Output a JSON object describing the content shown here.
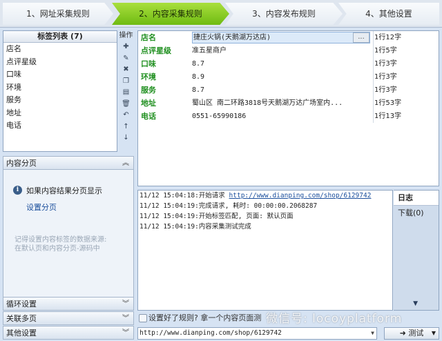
{
  "steps": [
    {
      "label": "1、网址采集规则"
    },
    {
      "label": "2、内容采集规则"
    },
    {
      "label": "3、内容发布规则"
    },
    {
      "label": "4、其他设置"
    }
  ],
  "taglist": {
    "header": "标签列表 (7)",
    "items": [
      "店名",
      "点评星级",
      "口味",
      "环境",
      "服务",
      "地址",
      "电话"
    ]
  },
  "ops": {
    "title": "操作",
    "icons": [
      "plus-icon",
      "pencil-icon",
      "delete-icon",
      "copy-icon",
      "paste-icon",
      "trash-icon",
      "undo-icon",
      "arrow-up-icon",
      "arrow-down-icon"
    ]
  },
  "grid": {
    "rows": [
      {
        "name": "店名",
        "value": "捷庄火锅(天鹅湖万达店)",
        "info": "1行12字",
        "button": "..."
      },
      {
        "name": "点评星级",
        "value": "准五星商户",
        "info": "1行5字"
      },
      {
        "name": "口味",
        "value": "8.7",
        "info": "1行3字"
      },
      {
        "name": "环境",
        "value": "8.9",
        "info": "1行3字"
      },
      {
        "name": "服务",
        "value": "8.7",
        "info": "1行3字"
      },
      {
        "name": "地址",
        "value": "蜀山区        南二环路3818号天鹅湖万达广场室内...",
        "info": "1行53字"
      },
      {
        "name": "电话",
        "value": "0551-65990186",
        "info": "1行13字"
      }
    ]
  },
  "left_panel": {
    "pager_title": "内容分页",
    "pager_hint": "如果内容结果分页显示",
    "pager_link": "设置分页",
    "pager_note": "记得设置内容标签的数据来源:\n在默认页和内容分页-源码中",
    "loop_settings": "循环设置",
    "related_pages": "关联多页",
    "other_settings": "其他设置"
  },
  "log": {
    "lines": [
      {
        "time": "11/12 15:04:18:",
        "text": "开始请求 ",
        "link": "http://www.dianping.com/shop/6129742"
      },
      {
        "time": "11/12 15:04:19:",
        "text": "完成请求, 耗时: 00:00:00.2068287"
      },
      {
        "time": "11/12 15:04:19:",
        "text": "开始标签匹配, 页面: 默认页面"
      },
      {
        "time": "11/12 15:04:19:",
        "text": "内容采集测试完成"
      }
    ]
  },
  "log_tabs": {
    "log": "日志",
    "download": "下载(0)"
  },
  "hintbar": {
    "text": "设置好了规则? 拿一个内容页面测"
  },
  "urlbar": {
    "value": "http://www.dianping.com/shop/6129742"
  },
  "test_button": {
    "label": "测试"
  },
  "watermark": {
    "text": "微信号: locoyplatform"
  },
  "colors": {
    "active_step": "#7ec21a",
    "tag_name": "#1f8f1f",
    "link": "#1a4e9c"
  }
}
